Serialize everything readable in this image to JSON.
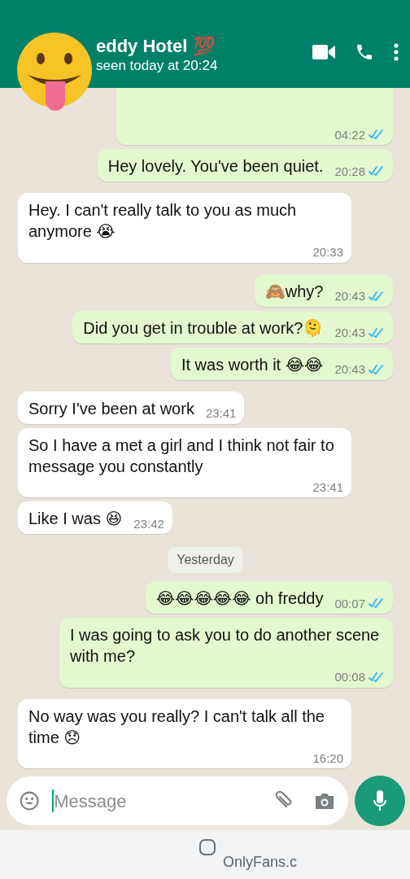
{
  "header": {
    "name": "eddy Hotel 💯",
    "status": "seen today at 20:24"
  },
  "messages": [
    {
      "kind": "out",
      "time": "04:22",
      "read": true
    },
    {
      "kind": "out",
      "text": "Hey lovely. You've been quiet.",
      "time": "20:28",
      "read": true
    },
    {
      "kind": "in",
      "text": "Hey. I can't really talk to you as much anymore 😭",
      "time": "20:33"
    },
    {
      "kind": "out",
      "text": "🙈why?",
      "time": "20:43",
      "read": true
    },
    {
      "kind": "out",
      "text": "Did you get in trouble at work?🫠",
      "time": "20:43",
      "read": true
    },
    {
      "kind": "out",
      "text": "It was worth it 😂😂",
      "time": "20:43",
      "read": true
    },
    {
      "kind": "in",
      "text": "Sorry I've been at work",
      "time": "23:41"
    },
    {
      "kind": "in",
      "text": "So I have a met a girl and I think not fair to message you constantly",
      "time": "23:41"
    },
    {
      "kind": "in",
      "text": "Like I was 😆",
      "time": "23:42"
    },
    {
      "kind": "date",
      "text": "Yesterday"
    },
    {
      "kind": "out",
      "text": "😂😂😂😂😂 oh freddy",
      "time": "00:07",
      "read": true
    },
    {
      "kind": "out",
      "text": "I was going to ask you to do another scene with me?",
      "time": "00:08",
      "read": true
    },
    {
      "kind": "in",
      "text": "No way was you really? I can't talk all the time 😞",
      "time": "16:20"
    }
  ],
  "composer": {
    "placeholder": "Message"
  },
  "browser_bar": {
    "url": "OnlyFans.c"
  }
}
